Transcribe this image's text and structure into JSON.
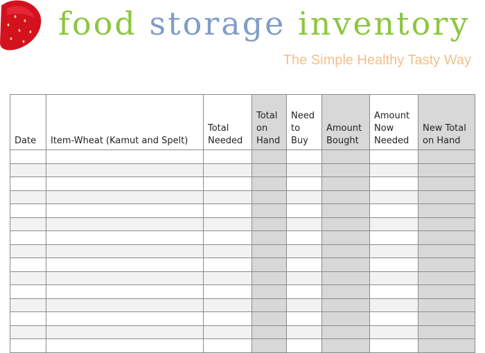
{
  "header": {
    "title_words": [
      "food",
      "storage",
      "inventory"
    ],
    "subtitle": "The Simple Healthy Tasty Way",
    "logo": "strawberry-logo"
  },
  "table": {
    "columns": [
      {
        "label": "Date",
        "shaded": false
      },
      {
        "label": "Item-Wheat (Kamut and Spelt)",
        "shaded": false
      },
      {
        "label": "Total Needed",
        "shaded": false
      },
      {
        "label": "Total on Hand",
        "shaded": true
      },
      {
        "label": "Need to Buy",
        "shaded": false
      },
      {
        "label": "Amount Bought",
        "shaded": true
      },
      {
        "label": "Amount Now Needed",
        "shaded": false
      },
      {
        "label": "New Total on Hand",
        "shaded": true
      }
    ],
    "row_count": 15
  },
  "colors": {
    "green": "#8cc63f",
    "blue": "#7f9cc7",
    "peach": "#f3c08a",
    "shade": "#d8d8d8"
  }
}
